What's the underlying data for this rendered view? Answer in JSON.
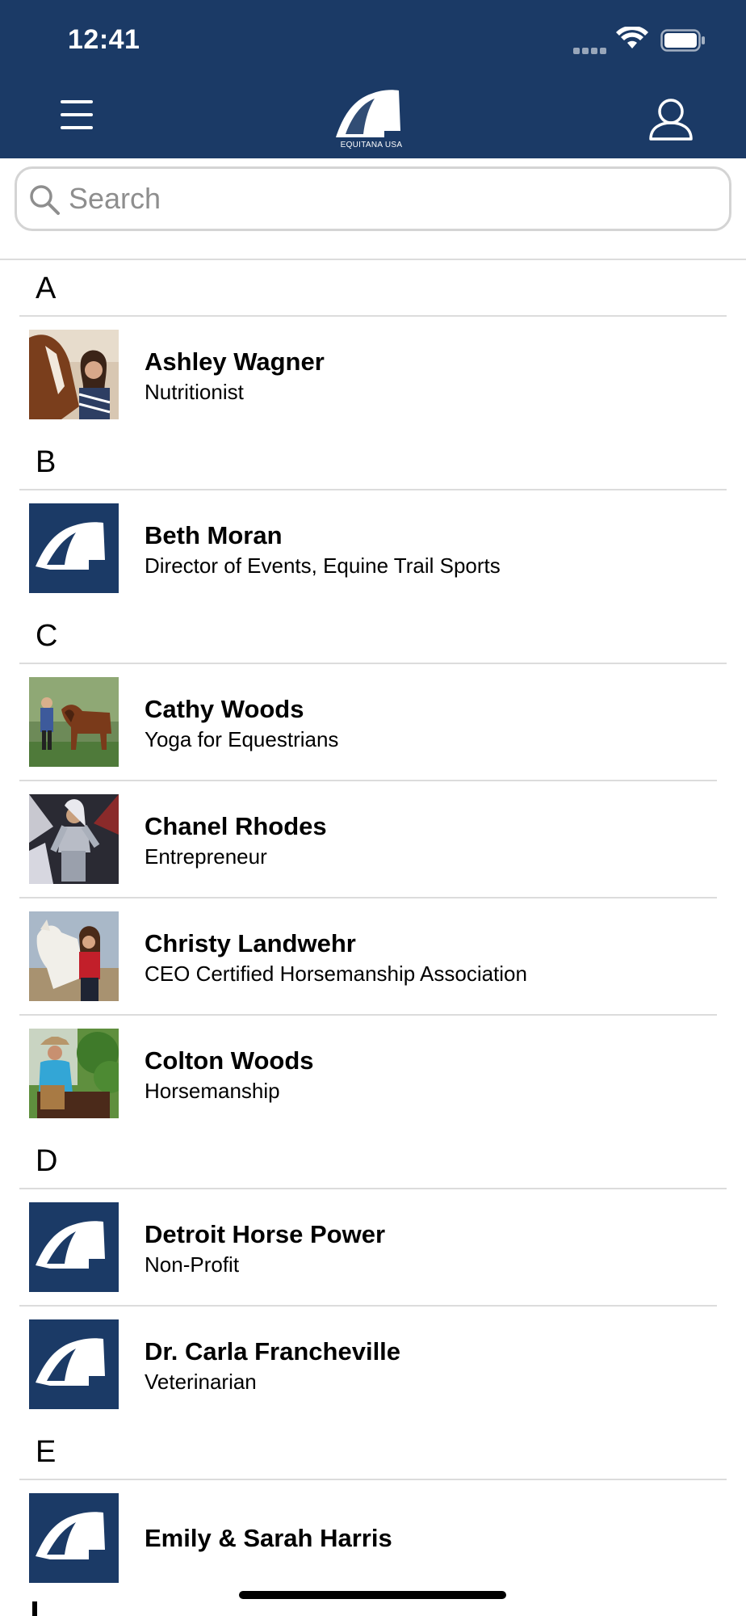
{
  "status_bar": {
    "time": "12:41"
  },
  "header": {
    "logo_text": "EQUITANA USA"
  },
  "search": {
    "placeholder": "Search"
  },
  "sections": [
    {
      "letter": "A",
      "items": [
        {
          "name": "Ashley Wagner",
          "subtitle": "Nutritionist",
          "thumb": "photo-horse-woman"
        }
      ]
    },
    {
      "letter": "B",
      "items": [
        {
          "name": "Beth Moran",
          "subtitle": "Director of Events, Equine Trail Sports",
          "thumb": "equitana-logo"
        }
      ]
    },
    {
      "letter": "C",
      "items": [
        {
          "name": "Cathy Woods",
          "subtitle": "Yoga for Equestrians",
          "thumb": "photo-woman-horses-field"
        },
        {
          "name": "Chanel Rhodes",
          "subtitle": "Entrepreneur",
          "thumb": "photo-woman-costume"
        },
        {
          "name": "Christy Landwehr",
          "subtitle": "CEO Certified Horsemanship Association",
          "thumb": "photo-woman-white-horse"
        },
        {
          "name": "Colton Woods",
          "subtitle": "Horsemanship",
          "thumb": "photo-cowboy-rider"
        }
      ]
    },
    {
      "letter": "D",
      "items": [
        {
          "name": "Detroit Horse Power",
          "subtitle": "Non-Profit",
          "thumb": "equitana-logo"
        },
        {
          "name": "Dr. Carla Francheville",
          "subtitle": "Veterinarian",
          "thumb": "equitana-logo"
        }
      ]
    },
    {
      "letter": "E",
      "items": [
        {
          "name": "Emily & Sarah Harris",
          "subtitle": "",
          "thumb": "equitana-logo"
        }
      ]
    }
  ],
  "colors": {
    "header": "#1b3a66",
    "divider": "#dcdcdc",
    "brand": "#1b3a66"
  },
  "icons": [
    "hamburger-menu-icon",
    "user-icon",
    "search-icon",
    "wifi-icon",
    "battery-icon",
    "equitana-logo"
  ]
}
